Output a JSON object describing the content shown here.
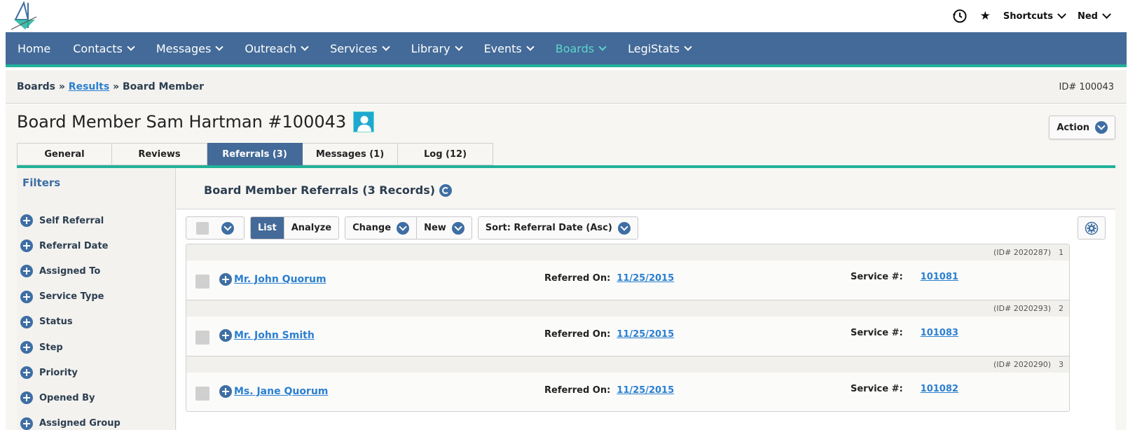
{
  "topbar": {
    "shortcuts_label": "Shortcuts",
    "user_label": "Ned"
  },
  "nav": {
    "items": [
      {
        "label": "Home"
      },
      {
        "label": "Contacts"
      },
      {
        "label": "Messages"
      },
      {
        "label": "Outreach"
      },
      {
        "label": "Services"
      },
      {
        "label": "Library"
      },
      {
        "label": "Events"
      },
      {
        "label": "Boards"
      },
      {
        "label": "LegiStats"
      }
    ],
    "active": "Boards"
  },
  "breadcrumb": {
    "first": "Boards",
    "sep1": " » ",
    "second": "Results",
    "sep2": " » ",
    "third": "Board Member",
    "id_text": "ID# 100043"
  },
  "page": {
    "title": "Board Member Sam Hartman #100043",
    "action_label": "Action"
  },
  "tabs": [
    {
      "label": "General"
    },
    {
      "label": "Reviews"
    },
    {
      "label": "Referrals (3)"
    },
    {
      "label": "Messages (1)"
    },
    {
      "label": "Log (12)"
    }
  ],
  "filters": {
    "title": "Filters",
    "items": [
      {
        "label": "Self Referral"
      },
      {
        "label": "Referral Date"
      },
      {
        "label": "Assigned To"
      },
      {
        "label": "Service Type"
      },
      {
        "label": "Status"
      },
      {
        "label": "Step"
      },
      {
        "label": "Priority"
      },
      {
        "label": "Opened By"
      },
      {
        "label": "Assigned Group"
      }
    ]
  },
  "panel": {
    "title": "Board Member Referrals (3 Records)",
    "toolbar": {
      "list": "List",
      "analyze": "Analyze",
      "change": "Change",
      "new": "New",
      "sort": "Sort: Referral Date (Asc)"
    },
    "referred_label": "Referred On:",
    "service_label": "Service #:",
    "records": [
      {
        "id": "(ID# 2020287)",
        "num": "1",
        "name": "Mr. John Quorum",
        "date": "11/25/2015",
        "service": "101081"
      },
      {
        "id": "(ID# 2020293)",
        "num": "2",
        "name": "Mr. John Smith",
        "date": "11/25/2015",
        "service": "101083"
      },
      {
        "id": "(ID# 2020290)",
        "num": "3",
        "name": "Ms. Jane Quorum",
        "date": "11/25/2015",
        "service": "101082"
      }
    ]
  },
  "colors": {
    "nav_bg": "#436a98",
    "accent": "#22b29a",
    "link": "#2b7fd0"
  }
}
